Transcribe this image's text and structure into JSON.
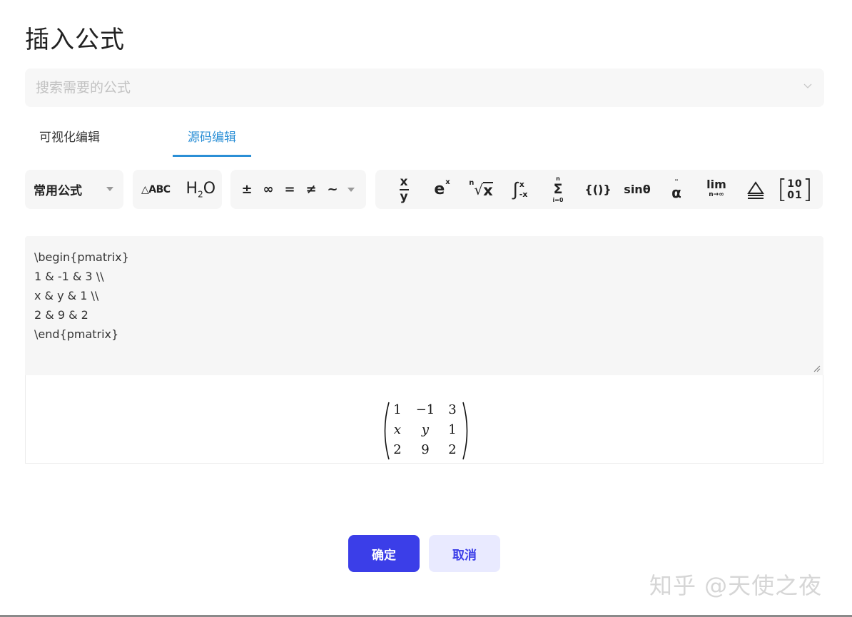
{
  "dialog": {
    "title": "插入公式"
  },
  "search": {
    "placeholder": "搜索需要的公式",
    "value": ""
  },
  "tabs": [
    {
      "label": "可视化编辑",
      "active": false
    },
    {
      "label": "源码编辑",
      "active": true
    }
  ],
  "toolbar": {
    "common_label": "常用公式",
    "text_group": {
      "abc": "△ABC",
      "h2o_main": "H",
      "h2o_sub": "2",
      "h2o_end": "O"
    },
    "symbols": [
      "±",
      "∞",
      "=",
      "≠",
      "~"
    ],
    "structures": {
      "frac_num": "x",
      "frac_den": "y",
      "exp_base": "e",
      "exp_sup": "x",
      "root_index": "n",
      "root_radicand": "x",
      "int_upper": "x",
      "int_lower": "-x",
      "sum_upper": "n",
      "sum_lower": "i=0",
      "brackets": "{()}",
      "trig": "sinθ",
      "accent": "α",
      "lim_main": "lim",
      "lim_sub": "n→∞",
      "matrix_r1": "10",
      "matrix_r2": "01"
    }
  },
  "editor": {
    "lines": [
      "\\begin{pmatrix}",
      "1 & -1 & 3 \\\\",
      "x & y & 1 \\\\",
      "2 & 9 & 2",
      "\\end{pmatrix}"
    ]
  },
  "preview": {
    "matrix": [
      [
        "1",
        "−1",
        "3"
      ],
      [
        "x",
        "y",
        "1"
      ],
      [
        "2",
        "9",
        "2"
      ]
    ]
  },
  "buttons": {
    "ok": "确定",
    "cancel": "取消"
  },
  "watermark": "知乎 @天使之夜",
  "colors": {
    "accent_tab": "#2b8fd6",
    "primary_button": "#3b3ee8",
    "secondary_button_bg": "#e9eaff"
  }
}
